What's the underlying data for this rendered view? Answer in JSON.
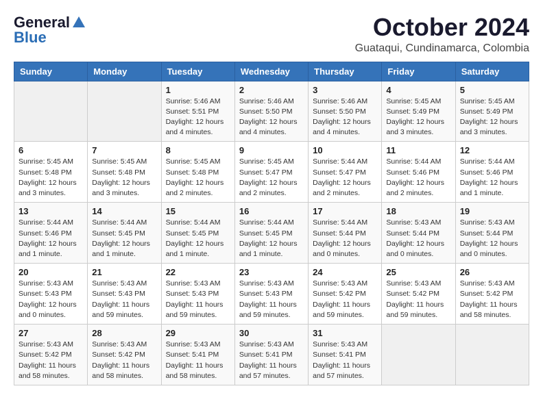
{
  "logo": {
    "general": "General",
    "blue": "Blue"
  },
  "header": {
    "month": "October 2024",
    "location": "Guataqui, Cundinamarca, Colombia"
  },
  "weekdays": [
    "Sunday",
    "Monday",
    "Tuesday",
    "Wednesday",
    "Thursday",
    "Friday",
    "Saturday"
  ],
  "weeks": [
    [
      {
        "day": "",
        "detail": ""
      },
      {
        "day": "",
        "detail": ""
      },
      {
        "day": "1",
        "detail": "Sunrise: 5:46 AM\nSunset: 5:51 PM\nDaylight: 12 hours\nand 4 minutes."
      },
      {
        "day": "2",
        "detail": "Sunrise: 5:46 AM\nSunset: 5:50 PM\nDaylight: 12 hours\nand 4 minutes."
      },
      {
        "day": "3",
        "detail": "Sunrise: 5:46 AM\nSunset: 5:50 PM\nDaylight: 12 hours\nand 4 minutes."
      },
      {
        "day": "4",
        "detail": "Sunrise: 5:45 AM\nSunset: 5:49 PM\nDaylight: 12 hours\nand 3 minutes."
      },
      {
        "day": "5",
        "detail": "Sunrise: 5:45 AM\nSunset: 5:49 PM\nDaylight: 12 hours\nand 3 minutes."
      }
    ],
    [
      {
        "day": "6",
        "detail": "Sunrise: 5:45 AM\nSunset: 5:48 PM\nDaylight: 12 hours\nand 3 minutes."
      },
      {
        "day": "7",
        "detail": "Sunrise: 5:45 AM\nSunset: 5:48 PM\nDaylight: 12 hours\nand 3 minutes."
      },
      {
        "day": "8",
        "detail": "Sunrise: 5:45 AM\nSunset: 5:48 PM\nDaylight: 12 hours\nand 2 minutes."
      },
      {
        "day": "9",
        "detail": "Sunrise: 5:45 AM\nSunset: 5:47 PM\nDaylight: 12 hours\nand 2 minutes."
      },
      {
        "day": "10",
        "detail": "Sunrise: 5:44 AM\nSunset: 5:47 PM\nDaylight: 12 hours\nand 2 minutes."
      },
      {
        "day": "11",
        "detail": "Sunrise: 5:44 AM\nSunset: 5:46 PM\nDaylight: 12 hours\nand 2 minutes."
      },
      {
        "day": "12",
        "detail": "Sunrise: 5:44 AM\nSunset: 5:46 PM\nDaylight: 12 hours\nand 1 minute."
      }
    ],
    [
      {
        "day": "13",
        "detail": "Sunrise: 5:44 AM\nSunset: 5:46 PM\nDaylight: 12 hours\nand 1 minute."
      },
      {
        "day": "14",
        "detail": "Sunrise: 5:44 AM\nSunset: 5:45 PM\nDaylight: 12 hours\nand 1 minute."
      },
      {
        "day": "15",
        "detail": "Sunrise: 5:44 AM\nSunset: 5:45 PM\nDaylight: 12 hours\nand 1 minute."
      },
      {
        "day": "16",
        "detail": "Sunrise: 5:44 AM\nSunset: 5:45 PM\nDaylight: 12 hours\nand 1 minute."
      },
      {
        "day": "17",
        "detail": "Sunrise: 5:44 AM\nSunset: 5:44 PM\nDaylight: 12 hours\nand 0 minutes."
      },
      {
        "day": "18",
        "detail": "Sunrise: 5:43 AM\nSunset: 5:44 PM\nDaylight: 12 hours\nand 0 minutes."
      },
      {
        "day": "19",
        "detail": "Sunrise: 5:43 AM\nSunset: 5:44 PM\nDaylight: 12 hours\nand 0 minutes."
      }
    ],
    [
      {
        "day": "20",
        "detail": "Sunrise: 5:43 AM\nSunset: 5:43 PM\nDaylight: 12 hours\nand 0 minutes."
      },
      {
        "day": "21",
        "detail": "Sunrise: 5:43 AM\nSunset: 5:43 PM\nDaylight: 11 hours\nand 59 minutes."
      },
      {
        "day": "22",
        "detail": "Sunrise: 5:43 AM\nSunset: 5:43 PM\nDaylight: 11 hours\nand 59 minutes."
      },
      {
        "day": "23",
        "detail": "Sunrise: 5:43 AM\nSunset: 5:43 PM\nDaylight: 11 hours\nand 59 minutes."
      },
      {
        "day": "24",
        "detail": "Sunrise: 5:43 AM\nSunset: 5:42 PM\nDaylight: 11 hours\nand 59 minutes."
      },
      {
        "day": "25",
        "detail": "Sunrise: 5:43 AM\nSunset: 5:42 PM\nDaylight: 11 hours\nand 59 minutes."
      },
      {
        "day": "26",
        "detail": "Sunrise: 5:43 AM\nSunset: 5:42 PM\nDaylight: 11 hours\nand 58 minutes."
      }
    ],
    [
      {
        "day": "27",
        "detail": "Sunrise: 5:43 AM\nSunset: 5:42 PM\nDaylight: 11 hours\nand 58 minutes."
      },
      {
        "day": "28",
        "detail": "Sunrise: 5:43 AM\nSunset: 5:42 PM\nDaylight: 11 hours\nand 58 minutes."
      },
      {
        "day": "29",
        "detail": "Sunrise: 5:43 AM\nSunset: 5:41 PM\nDaylight: 11 hours\nand 58 minutes."
      },
      {
        "day": "30",
        "detail": "Sunrise: 5:43 AM\nSunset: 5:41 PM\nDaylight: 11 hours\nand 57 minutes."
      },
      {
        "day": "31",
        "detail": "Sunrise: 5:43 AM\nSunset: 5:41 PM\nDaylight: 11 hours\nand 57 minutes."
      },
      {
        "day": "",
        "detail": ""
      },
      {
        "day": "",
        "detail": ""
      }
    ]
  ]
}
